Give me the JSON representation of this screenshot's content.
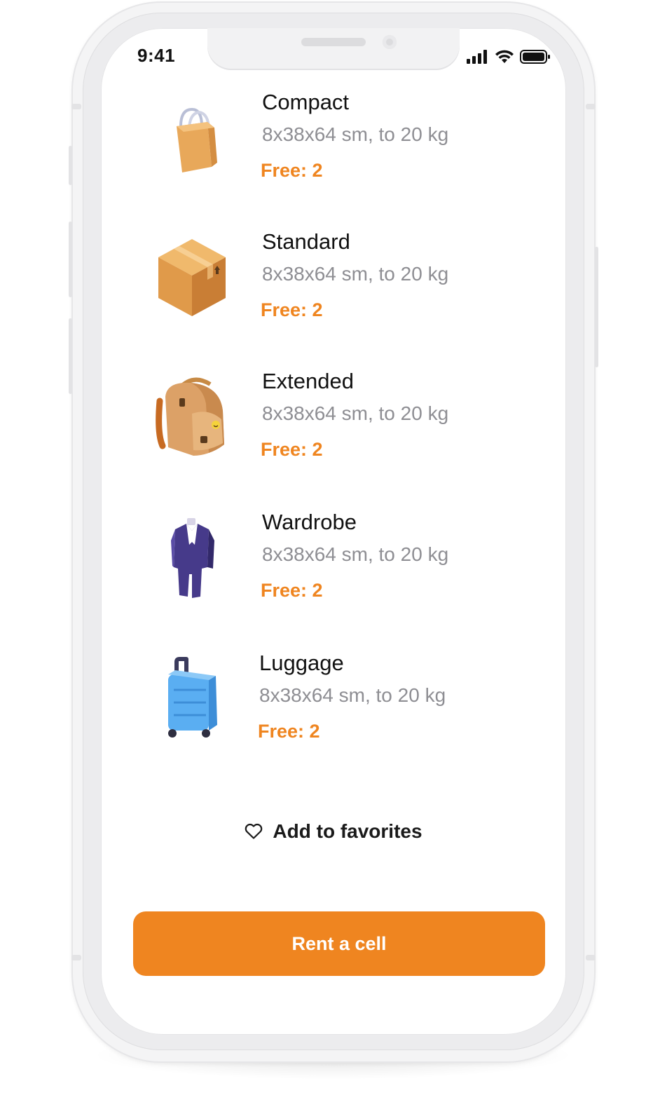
{
  "status_bar": {
    "time": "9:41",
    "icons": [
      "signal-icon",
      "wifi-icon",
      "battery-icon"
    ]
  },
  "cells": [
    {
      "title": "Compact",
      "dims": "8x38x64 sm, to 20 kg",
      "free": "Free: 2",
      "icon": "shopping-bag-icon"
    },
    {
      "title": "Standard",
      "dims": "8x38x64 sm, to 20 kg",
      "free": "Free: 2",
      "icon": "cardboard-box-icon"
    },
    {
      "title": "Extended",
      "dims": "8x38x64 sm, to 20 kg",
      "free": "Free: 2",
      "icon": "backpack-icon"
    },
    {
      "title": "Wardrobe",
      "dims": "8x38x64 sm, to 20 kg",
      "free": "Free: 2",
      "icon": "suit-icon"
    },
    {
      "title": "Luggage",
      "dims": "8x38x64 sm, to 20 kg",
      "free": "Free: 2",
      "icon": "suitcase-icon"
    }
  ],
  "favorites": {
    "label": "Add to favorites",
    "icon": "heart-icon"
  },
  "primary_action": {
    "label": "Rent a cell"
  },
  "colors": {
    "accent": "#ef8520",
    "muted": "#8e8e93",
    "text": "#111111"
  }
}
